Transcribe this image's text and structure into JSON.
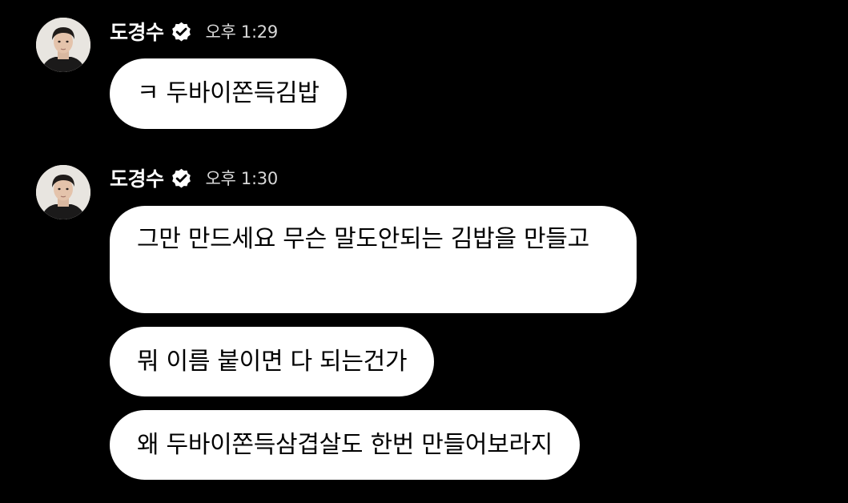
{
  "colors": {
    "background": "#000000",
    "bubble": "#ffffff",
    "bubble_text": "#000000",
    "name_text": "#ffffff",
    "timestamp_text": "#d8d8d8",
    "verified_badge": "#ffffff"
  },
  "messages": [
    {
      "sender": "도경수",
      "verified_icon": "verified-badge-icon",
      "time": "오후 1:29",
      "bubbles": [
        "ㅋ 두바이쫀득김밥"
      ]
    },
    {
      "sender": "도경수",
      "verified_icon": "verified-badge-icon",
      "time": "오후 1:30",
      "bubbles": [
        "그만 만드세요 무슨 말도안되는 김밥을 만들고",
        "뭐 이름 붙이면 다 되는건가",
        "왜 두바이쫀득삼겹살도 한번 만들어보라지"
      ]
    }
  ]
}
